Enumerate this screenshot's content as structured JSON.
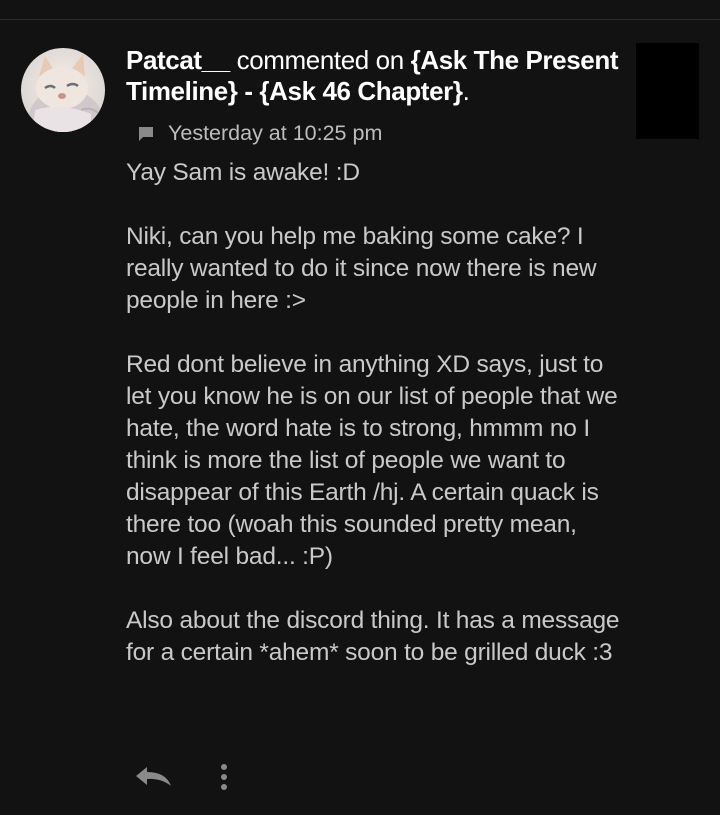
{
  "comment": {
    "author": "Patcat__",
    "verb": "commented on",
    "target": "{Ask The Present Timeline} - {Ask 46 Chapter}",
    "target_end": ".",
    "timestamp": "Yesterday at 10:25 pm",
    "paragraphs": [
      "Yay Sam is awake! :D",
      "Niki, can you help me baking some cake? I really wanted to do it since now there is new people in here :>",
      "Red dont believe in anything XD says, just to let you know he is on our list of people that we hate, the word hate is to strong, hmmm no I think is more the list of people we want to disappear of this Earth /hj. A certain quack is there too (woah this sounded pretty mean, now I feel bad... :P)",
      "Also about the discord thing. It has a message for a certain *ahem* soon to be grilled duck :3"
    ]
  },
  "icons": {
    "comment": "comment-bubble-icon",
    "reply": "reply-arrow-icon",
    "more": "more-vertical-icon"
  },
  "colors": {
    "background": "#121212",
    "header_text": "#ffffff",
    "body_text": "#c9c9c9",
    "icon": "#8a8a8a"
  }
}
